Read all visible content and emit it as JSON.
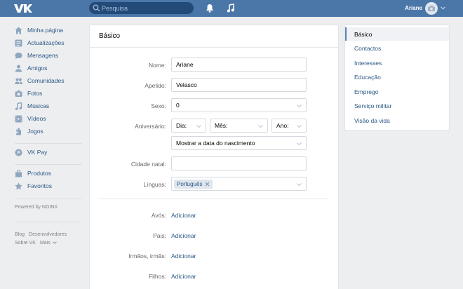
{
  "header": {
    "search_placeholder": "Pesquisa",
    "user_name": "Ariane"
  },
  "nav": {
    "items": [
      {
        "label": "Minha página",
        "icon": "home-icon"
      },
      {
        "label": "Actualizações",
        "icon": "news-icon"
      },
      {
        "label": "Mensagens",
        "icon": "messages-icon"
      },
      {
        "label": "Amigos",
        "icon": "friends-icon"
      },
      {
        "label": "Comunidades",
        "icon": "communities-icon"
      },
      {
        "label": "Fotos",
        "icon": "camera-icon"
      },
      {
        "label": "Músicas",
        "icon": "music-icon"
      },
      {
        "label": "Vídeos",
        "icon": "video-icon"
      },
      {
        "label": "Jogos",
        "icon": "games-icon"
      },
      {
        "label": "VK Pay",
        "icon": "vkpay-icon"
      },
      {
        "label": "Produtos",
        "icon": "bag-icon"
      },
      {
        "label": "Favoritos",
        "icon": "star-icon"
      }
    ],
    "powered": "Powered by NGINX",
    "footer": [
      "Blog",
      "Desenvolvedores",
      "Sobre VK",
      "Mais"
    ]
  },
  "form": {
    "title": "Básico",
    "name_label": "Nome:",
    "name_value": "Ariane",
    "surname_label": "Apelido:",
    "surname_value": "Velasco",
    "sex_label": "Sexo:",
    "sex_value": "0",
    "birthday_label": "Aniversário:",
    "day_value": "Dia:",
    "month_value": "Mês:",
    "year_value": "Ano:",
    "birthday_visibility": "Mostrar a data do nascimento",
    "hometown_label": "Cidade natal:",
    "hometown_value": "",
    "languages_label": "Línguas:",
    "language_tag": "Português",
    "grandparents_label": "Avós:",
    "parents_label": "Pais:",
    "siblings_label": "Irmãos, irmãs:",
    "children_label": "Filhos:",
    "add_label": "Adicionar"
  },
  "menu": {
    "items": [
      "Básico",
      "Contactos",
      "Interesses",
      "Educação",
      "Emprego",
      "Serviço militar",
      "Visão da vida"
    ]
  },
  "colors": {
    "header": "#4a76a8",
    "link": "#2a5885",
    "background": "#edeef0"
  }
}
